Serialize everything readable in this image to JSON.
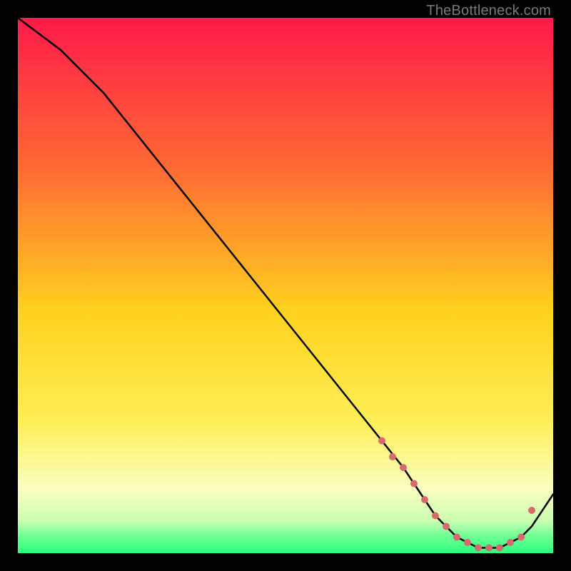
{
  "watermark": "TheBottleneck.com",
  "colors": {
    "bg": "#000000",
    "grad_top": "#ff1a4a",
    "grad_mid_upper": "#ff7b2e",
    "grad_mid": "#ffd21e",
    "grad_mid_lower": "#ffee55",
    "grad_pale": "#faffc0",
    "grad_green": "#2dff7a",
    "curve": "#000000",
    "marker": "#d86a6d",
    "watermark": "#7a7a7a"
  },
  "chart_data": {
    "type": "line",
    "title": "",
    "xlabel": "",
    "ylabel": "",
    "xlim": [
      0,
      100
    ],
    "ylim": [
      0,
      100
    ],
    "series": [
      {
        "name": "bottleneck-curve",
        "x": [
          0,
          4,
          8,
          12,
          16,
          20,
          24,
          28,
          32,
          36,
          40,
          44,
          48,
          52,
          56,
          60,
          64,
          68,
          72,
          74,
          76,
          78,
          80,
          82,
          84,
          86,
          88,
          90,
          92,
          94,
          96,
          98,
          100
        ],
        "y": [
          100,
          97,
          94,
          90,
          86,
          81,
          76,
          71,
          66,
          61,
          56,
          51,
          46,
          41,
          36,
          31,
          26,
          21,
          16,
          13,
          10,
          7,
          5,
          3,
          2,
          1,
          1,
          1,
          2,
          3,
          5,
          8,
          11
        ]
      }
    ],
    "markers": {
      "name": "highlight-dots",
      "x": [
        68,
        70,
        72,
        74,
        76,
        78,
        80,
        82,
        84,
        86,
        88,
        90,
        92,
        94,
        96
      ],
      "y": [
        21,
        18,
        16,
        13,
        10,
        7,
        5,
        3,
        2,
        1,
        1,
        1,
        2,
        3,
        8
      ]
    }
  }
}
